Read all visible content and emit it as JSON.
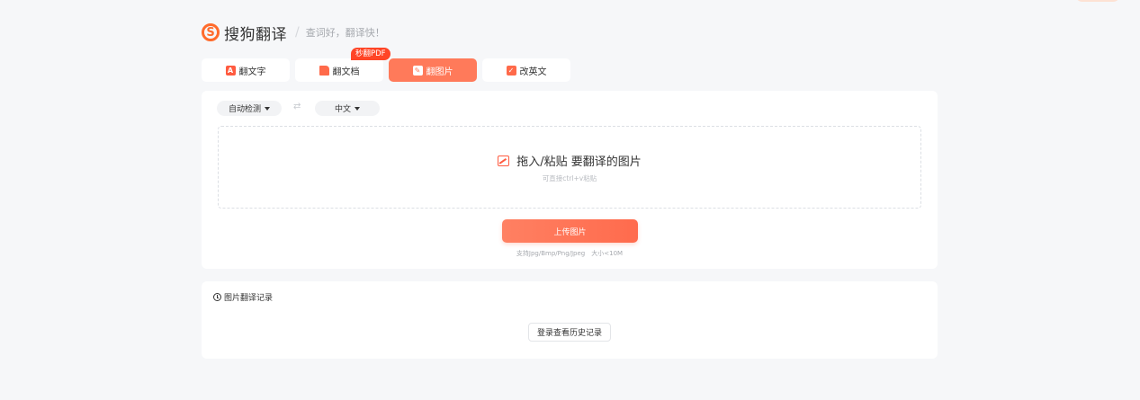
{
  "header": {
    "logo_glyph": "S",
    "logo_text": "搜狗翻译",
    "separator": "/",
    "slogan": "查词好，翻译快！"
  },
  "tabs": [
    {
      "label": "翻文字",
      "icon": "text-translate-icon",
      "icon_glyph": "A",
      "active": false
    },
    {
      "label": "翻文档",
      "icon": "document-icon",
      "active": false,
      "badge": "秒翻PDF"
    },
    {
      "label": "翻图片",
      "icon": "image-edit-icon",
      "icon_glyph": "✎",
      "active": true
    },
    {
      "label": "改英文",
      "icon": "english-edit-icon",
      "icon_glyph": "✓",
      "active": false
    }
  ],
  "translator": {
    "source_lang": "自动检测",
    "swap_glyph": "⇄",
    "target_lang": "中文",
    "drop_title": "拖入/粘贴 要翻译的图片",
    "drop_hint": "可直接ctrl+v粘贴",
    "upload_label": "上传图片",
    "upload_hint": "支持Jpg/Bmp/Png/Jpeg　大小<10M"
  },
  "history": {
    "title": "图片翻译记录",
    "login_label": "登录查看历史记录"
  },
  "colors": {
    "accent": "#ff7a5a",
    "brand": "#ff6b2c",
    "badge": "#ff4526",
    "background": "#f6f7f9"
  }
}
